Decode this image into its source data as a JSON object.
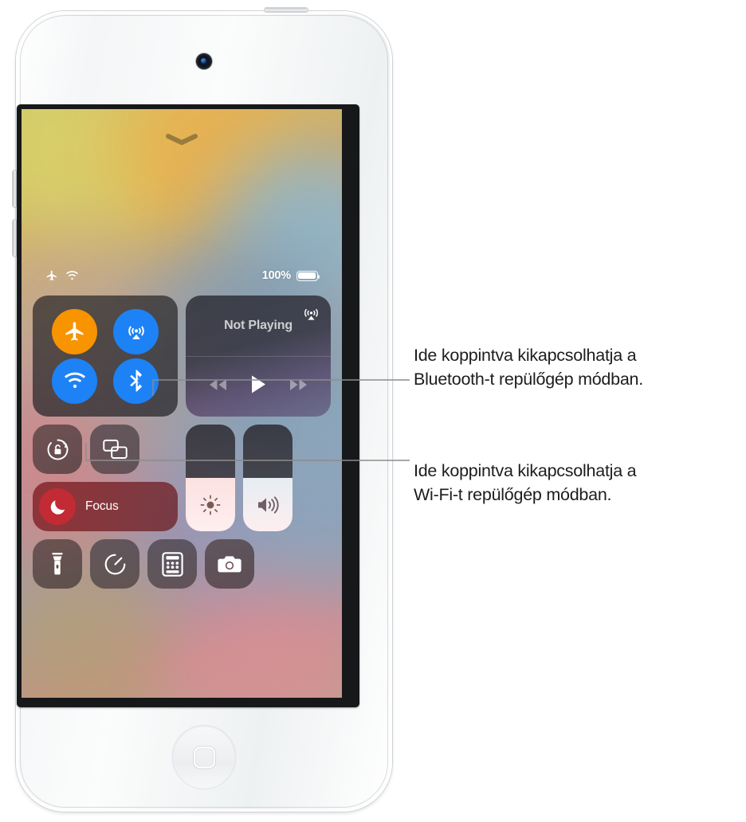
{
  "device": {
    "name": "iPod touch",
    "camera": "front-camera",
    "home_button": "home-button"
  },
  "screen": {
    "handle_icon": "chevron-down-icon",
    "status_bar": {
      "airplane_icon": "airplane-mode-icon",
      "wifi_icon": "wifi-icon",
      "battery_percent": "100%",
      "battery_icon": "battery-full-icon"
    },
    "control_center": {
      "connectivity": {
        "name": "connectivity-tile",
        "buttons": [
          {
            "name": "airplane-mode-button",
            "icon": "airplane-icon",
            "state": "on",
            "color": "#f79400"
          },
          {
            "name": "airdrop-button",
            "icon": "airdrop-icon",
            "state": "on",
            "color": "#1d82f5"
          },
          {
            "name": "wifi-button",
            "icon": "wifi-icon",
            "state": "on",
            "color": "#1d82f5"
          },
          {
            "name": "bluetooth-button",
            "icon": "bluetooth-icon",
            "state": "on",
            "color": "#1d82f5"
          }
        ]
      },
      "media": {
        "name": "now-playing-tile",
        "title": "Not Playing",
        "airplay_icon": "airplay-icon",
        "controls": [
          {
            "name": "rewind-button",
            "icon": "rewind-icon"
          },
          {
            "name": "play-button",
            "icon": "play-icon"
          },
          {
            "name": "fast-forward-button",
            "icon": "fast-forward-icon"
          }
        ]
      },
      "rotation_lock": {
        "name": "rotation-lock-button",
        "icon": "rotation-lock-icon"
      },
      "screen_mirroring": {
        "name": "screen-mirroring-button",
        "icon": "screen-mirroring-icon"
      },
      "focus": {
        "name": "focus-button",
        "label": "Focus",
        "icon": "moon-icon",
        "color": "#c22b33"
      },
      "brightness": {
        "name": "brightness-slider",
        "icon": "brightness-icon",
        "value": 50
      },
      "volume": {
        "name": "volume-slider",
        "icon": "volume-icon",
        "value": 50
      },
      "utilities": [
        {
          "name": "flashlight-button",
          "icon": "flashlight-icon"
        },
        {
          "name": "timer-button",
          "icon": "timer-icon"
        },
        {
          "name": "calculator-button",
          "icon": "calculator-icon"
        },
        {
          "name": "camera-button",
          "icon": "camera-icon"
        }
      ]
    }
  },
  "callouts": {
    "bluetooth": {
      "line1": "Ide koppintva kikapcsolhatja a",
      "line2": "Bluetooth-t repülőgép módban."
    },
    "wifi": {
      "line1": "Ide koppintva kikapcsolhatja a",
      "line2": "Wi-Fi-t repülőgép módban."
    }
  }
}
